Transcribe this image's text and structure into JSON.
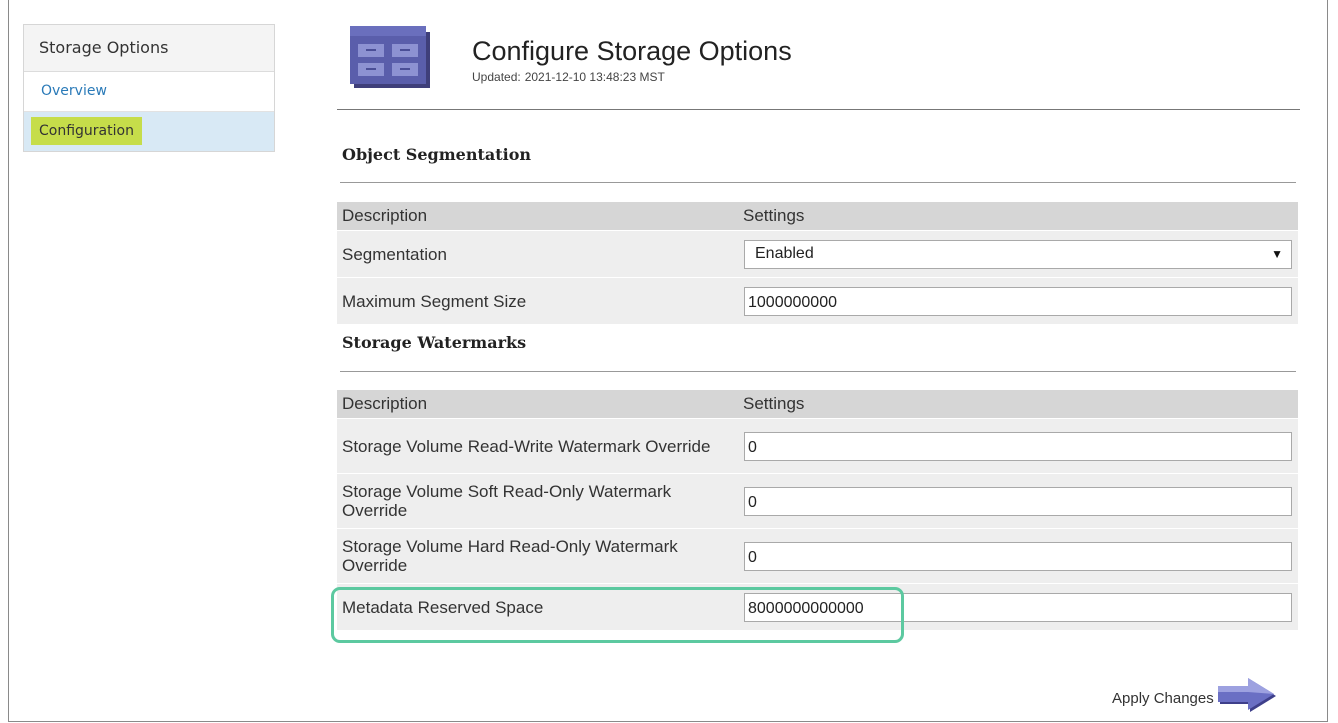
{
  "sidebar": {
    "title": "Storage Options",
    "items": [
      {
        "label": "Overview"
      },
      {
        "label": "Configuration"
      }
    ]
  },
  "header": {
    "title": "Configure Storage Options",
    "updated_label": "Updated:",
    "updated_value": "2021-12-10 13:48:23 MST",
    "icon": "storage-cabinet-icon"
  },
  "object_segmentation": {
    "title": "Object Segmentation",
    "columns": [
      "Description",
      "Settings"
    ],
    "rows": [
      {
        "label": "Segmentation",
        "type": "select",
        "value": "Enabled"
      },
      {
        "label": "Maximum Segment Size",
        "type": "input",
        "value": "1000000000"
      }
    ]
  },
  "storage_watermarks": {
    "title": "Storage Watermarks",
    "columns": [
      "Description",
      "Settings"
    ],
    "rows": [
      {
        "label": "Storage Volume Read-Write Watermark Override",
        "value": "0"
      },
      {
        "label": "Storage Volume Soft Read-Only Watermark Override",
        "value": "0"
      },
      {
        "label": "Storage Volume Hard Read-Only Watermark Override",
        "value": "0"
      },
      {
        "label": "Metadata Reserved Space",
        "value": "8000000000000"
      }
    ]
  },
  "apply": {
    "label": "Apply Changes",
    "icon": "arrow-right-icon"
  },
  "colors": {
    "highlight_outline": "#5cc9a0",
    "active_item_bg": "#d8e9f5",
    "active_item_marker": "#c6dd4a",
    "link": "#2a7ab8",
    "table_header_bg": "#d6d6d6",
    "table_row_bg": "#eeeeee",
    "icon_blue": "#5a5eab"
  }
}
